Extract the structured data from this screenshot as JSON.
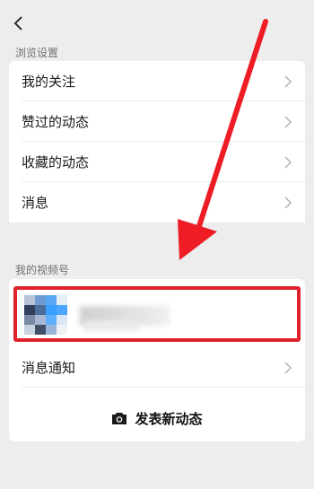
{
  "nav": {
    "back_icon": "chevron-left-icon"
  },
  "browse": {
    "title": "浏览设置",
    "items": [
      {
        "label": "我的关注"
      },
      {
        "label": "赞过的动态"
      },
      {
        "label": "收藏的动态"
      },
      {
        "label": "消息"
      }
    ]
  },
  "channel": {
    "title": "我的视频号",
    "notify_label": "消息通知",
    "post_label": "发表新动态",
    "post_icon": "camera-icon"
  },
  "colors": {
    "background": "#ededed",
    "highlight": "#e1212b",
    "annotation_arrow": "#ee1c25"
  }
}
